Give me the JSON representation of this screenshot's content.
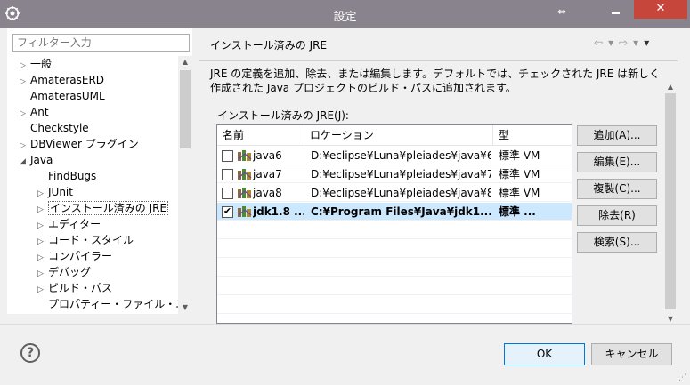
{
  "window": {
    "title": "設定",
    "move_glyph": "⇔",
    "close_glyph": "✕"
  },
  "left": {
    "filter_placeholder": "フィルター入力",
    "tree": [
      {
        "label": "一般",
        "arrow": "▷",
        "depth": 0
      },
      {
        "label": "AmaterasERD",
        "arrow": "▷",
        "depth": 0
      },
      {
        "label": "AmaterasUML",
        "arrow": "",
        "depth": 0
      },
      {
        "label": "Ant",
        "arrow": "▷",
        "depth": 0
      },
      {
        "label": "Checkstyle",
        "arrow": "",
        "depth": 0
      },
      {
        "label": "DBViewer プラグイン",
        "arrow": "▷",
        "depth": 0
      },
      {
        "label": "Java",
        "arrow": "◢",
        "depth": 0
      },
      {
        "label": "FindBugs",
        "arrow": "",
        "depth": 1
      },
      {
        "label": "JUnit",
        "arrow": "▷",
        "depth": 1
      },
      {
        "label": "インストール済みの JRE",
        "arrow": "▷",
        "depth": 1,
        "selected": true
      },
      {
        "label": "エディター",
        "arrow": "▷",
        "depth": 1
      },
      {
        "label": "コード・スタイル",
        "arrow": "▷",
        "depth": 1
      },
      {
        "label": "コンパイラー",
        "arrow": "▷",
        "depth": 1
      },
      {
        "label": "デバッグ",
        "arrow": "▷",
        "depth": 1
      },
      {
        "label": "ビルド・パス",
        "arrow": "▷",
        "depth": 1
      },
      {
        "label": "プロパティー・ファイル・エディター",
        "arrow": "",
        "depth": 1
      }
    ]
  },
  "right": {
    "title": "インストール済みの JRE",
    "nav": {
      "back": "⇦",
      "back_menu": "▾",
      "forward": "⇨",
      "forward_menu": "▾",
      "menu": "▾"
    },
    "description": "JRE の定義を追加、除去、または編集します。デフォルトでは、チェックされた JRE は新しく作成された Java プロジェクトのビルド・パスに追加されます。",
    "jre_label": "インストール済みの JRE(J):",
    "table": {
      "headers": [
        "名前",
        "ロケーション",
        "型"
      ],
      "rows": [
        {
          "name": "java6",
          "location": "D:¥eclipse¥Luna¥pleiades¥java¥6",
          "type": "標準 VM",
          "checked": false
        },
        {
          "name": "java7",
          "location": "D:¥eclipse¥Luna¥pleiades¥java¥7",
          "type": "標準 VM",
          "checked": false
        },
        {
          "name": "java8",
          "location": "D:¥eclipse¥Luna¥pleiades¥java¥8",
          "type": "標準 VM",
          "checked": false
        },
        {
          "name": "jdk1.8 ...",
          "location": "C:¥Program Files¥Java¥jdk1...",
          "type": "標準 ...",
          "checked": true
        }
      ]
    },
    "buttons": [
      "追加(A)...",
      "編集(E)...",
      "複製(C)...",
      "除去(R)",
      "検索(S)..."
    ]
  },
  "footer": {
    "help_glyph": "?",
    "ok": "OK",
    "cancel": "キャンセル"
  },
  "colors": {
    "titlebar": "#88838d",
    "close": "#c7463c",
    "selected_row": "#cce8ff",
    "ok_border": "#0078d7"
  }
}
